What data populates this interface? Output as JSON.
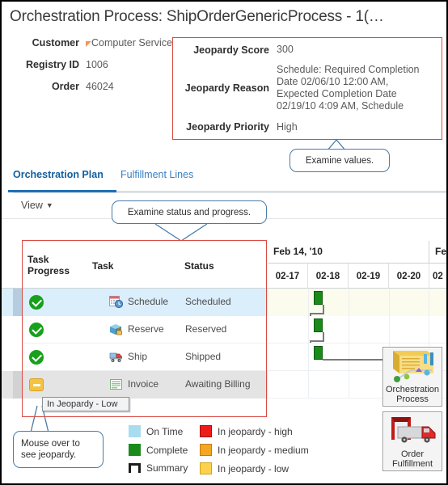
{
  "page_title": "Orchestration Process: ShipOrderGenericProcess - 1(…",
  "summary": {
    "rows": [
      {
        "label": "Customer",
        "value": "Computer Service",
        "icon": "orange-flag-icon"
      },
      {
        "label": "Registry ID",
        "value": "1006",
        "icon": ""
      },
      {
        "label": "Order",
        "value": "46024",
        "icon": ""
      }
    ]
  },
  "jeopardy": {
    "score_label": "Jeopardy Score",
    "score_value": "300",
    "reason_label": "Jeopardy Reason",
    "reason_value": "Schedule: Required Completion Date 02/06/10 12:00 AM, Expected Completion Date 02/19/10 4:09 AM, Schedule",
    "priority_label": "Jeopardy Priority",
    "priority_value": "High",
    "border_color": "#d94b43"
  },
  "callouts": {
    "examine_values": "Examine values.",
    "examine_status": "Examine status and progress.",
    "mouse_over": "Mouse over  to see jeopardy."
  },
  "tabs": {
    "items": [
      {
        "label": "Orchestration Plan",
        "active": true
      },
      {
        "label": "Fulfillment Lines",
        "active": false
      }
    ],
    "active_color": "#14609e"
  },
  "toolbar": {
    "view_label": "View",
    "view_caret": "▼"
  },
  "table": {
    "headers": [
      "Task Progress",
      "Task",
      "Status"
    ],
    "header_task_progress_line1": "Task",
    "header_task_progress_line2": "Progress",
    "rows": [
      {
        "progress_icon": "green-check-icon",
        "progress_state": "complete",
        "task_icon": "calendar-clock-icon",
        "task": "Schedule",
        "status": "Scheduled",
        "selected": true
      },
      {
        "progress_icon": "green-check-icon",
        "progress_state": "complete",
        "task_icon": "box-lock-icon",
        "task": "Reserve",
        "status": "Reserved",
        "selected": false
      },
      {
        "progress_icon": "green-check-icon",
        "progress_state": "complete",
        "task_icon": "truck-icon",
        "task": "Ship",
        "status": "Shipped",
        "selected": false
      },
      {
        "progress_icon": "yellow-minus-icon",
        "progress_state": "in-jeopardy-low",
        "task_icon": "invoice-grid-icon",
        "task": "Invoice",
        "status": "Awaiting Billing",
        "selected": false
      }
    ]
  },
  "tooltip": {
    "text": "In Jeopardy - Low"
  },
  "gantt": {
    "months": [
      "Feb 14, '10",
      "Fe"
    ],
    "days": [
      "02-17",
      "02-18",
      "02-19",
      "02-20",
      "02"
    ],
    "bars": [
      {
        "task": "Schedule",
        "day": "02-18",
        "type": "complete"
      },
      {
        "task": "Reserve",
        "day": "02-18",
        "type": "complete"
      },
      {
        "task": "Ship",
        "day": "02-18",
        "type": "complete"
      }
    ]
  },
  "side_icons": [
    {
      "name": "orchestration-process-icon",
      "line1": "Orchestration",
      "line2": "Process"
    },
    {
      "name": "order-fulfillment-icon",
      "line1": "Order",
      "line2": "Fulfillment"
    }
  ],
  "legend": {
    "items": [
      {
        "label": "On Time",
        "color": "#a8dcf0",
        "swatch": "ontime"
      },
      {
        "label": "Complete",
        "color": "#1a8a1a",
        "swatch": "complete"
      },
      {
        "label": "Summary",
        "color": "#1c1c1c",
        "swatch": "summary"
      },
      {
        "label": "In jeopardy - high",
        "color": "#ee1b1b",
        "swatch": "high"
      },
      {
        "label": "In jeopardy - medium",
        "color": "#f5a623",
        "swatch": "medium"
      },
      {
        "label": "In jeopardy - low",
        "color": "#fad24b",
        "swatch": "low"
      }
    ]
  }
}
